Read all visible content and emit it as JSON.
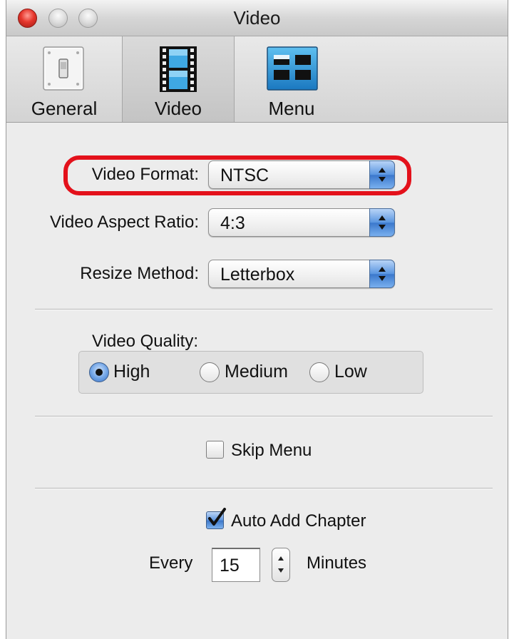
{
  "window": {
    "title": "Video"
  },
  "toolbar": {
    "tabs": [
      {
        "label": "General",
        "icon": "switch-icon",
        "selected": false
      },
      {
        "label": "Video",
        "icon": "film-strip-icon",
        "selected": true
      },
      {
        "label": "Menu",
        "icon": "menu-grid-icon",
        "selected": false
      }
    ]
  },
  "video_settings": {
    "format_label": "Video Format:",
    "format_value": "NTSC",
    "aspect_label": "Video Aspect Ratio:",
    "aspect_value": "4:3",
    "resize_label": "Resize Method:",
    "resize_value": "Letterbox"
  },
  "quality": {
    "label": "Video Quality:",
    "options": [
      {
        "label": "High",
        "selected": true
      },
      {
        "label": "Medium",
        "selected": false
      },
      {
        "label": "Low",
        "selected": false
      }
    ]
  },
  "skip_menu": {
    "label": "Skip Menu",
    "checked": false
  },
  "chapters": {
    "auto_add_label": "Auto Add Chapter",
    "auto_add_checked": true,
    "every_label": "Every",
    "interval_value": "15",
    "unit_label": "Minutes"
  },
  "colors": {
    "highlight": "#e3111b",
    "accent": "#3b78cc"
  }
}
